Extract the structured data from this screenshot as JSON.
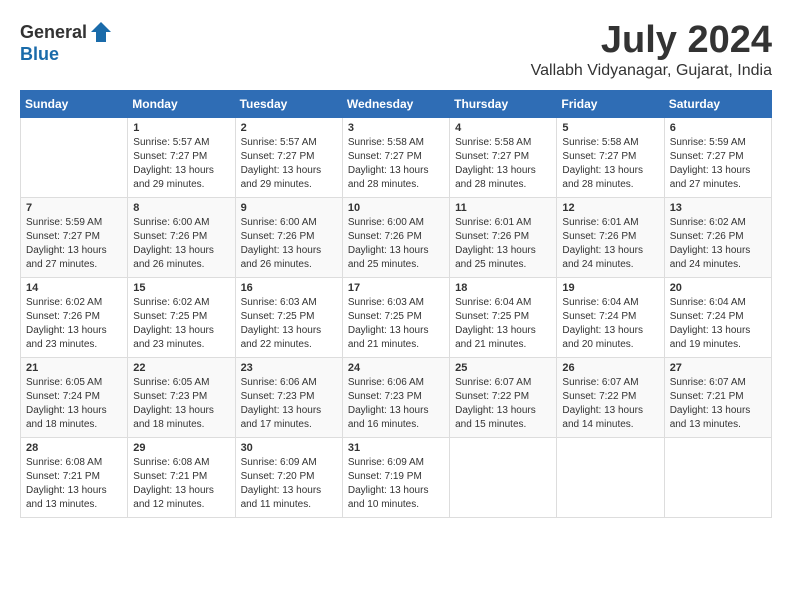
{
  "header": {
    "logo_general": "General",
    "logo_blue": "Blue",
    "month_title": "July 2024",
    "location": "Vallabh Vidyanagar, Gujarat, India"
  },
  "calendar": {
    "days_of_week": [
      "Sunday",
      "Monday",
      "Tuesday",
      "Wednesday",
      "Thursday",
      "Friday",
      "Saturday"
    ],
    "weeks": [
      [
        {
          "day": "",
          "info": ""
        },
        {
          "day": "1",
          "info": "Sunrise: 5:57 AM\nSunset: 7:27 PM\nDaylight: 13 hours\nand 29 minutes."
        },
        {
          "day": "2",
          "info": "Sunrise: 5:57 AM\nSunset: 7:27 PM\nDaylight: 13 hours\nand 29 minutes."
        },
        {
          "day": "3",
          "info": "Sunrise: 5:58 AM\nSunset: 7:27 PM\nDaylight: 13 hours\nand 28 minutes."
        },
        {
          "day": "4",
          "info": "Sunrise: 5:58 AM\nSunset: 7:27 PM\nDaylight: 13 hours\nand 28 minutes."
        },
        {
          "day": "5",
          "info": "Sunrise: 5:58 AM\nSunset: 7:27 PM\nDaylight: 13 hours\nand 28 minutes."
        },
        {
          "day": "6",
          "info": "Sunrise: 5:59 AM\nSunset: 7:27 PM\nDaylight: 13 hours\nand 27 minutes."
        }
      ],
      [
        {
          "day": "7",
          "info": "Sunrise: 5:59 AM\nSunset: 7:27 PM\nDaylight: 13 hours\nand 27 minutes."
        },
        {
          "day": "8",
          "info": "Sunrise: 6:00 AM\nSunset: 7:26 PM\nDaylight: 13 hours\nand 26 minutes."
        },
        {
          "day": "9",
          "info": "Sunrise: 6:00 AM\nSunset: 7:26 PM\nDaylight: 13 hours\nand 26 minutes."
        },
        {
          "day": "10",
          "info": "Sunrise: 6:00 AM\nSunset: 7:26 PM\nDaylight: 13 hours\nand 25 minutes."
        },
        {
          "day": "11",
          "info": "Sunrise: 6:01 AM\nSunset: 7:26 PM\nDaylight: 13 hours\nand 25 minutes."
        },
        {
          "day": "12",
          "info": "Sunrise: 6:01 AM\nSunset: 7:26 PM\nDaylight: 13 hours\nand 24 minutes."
        },
        {
          "day": "13",
          "info": "Sunrise: 6:02 AM\nSunset: 7:26 PM\nDaylight: 13 hours\nand 24 minutes."
        }
      ],
      [
        {
          "day": "14",
          "info": "Sunrise: 6:02 AM\nSunset: 7:26 PM\nDaylight: 13 hours\nand 23 minutes."
        },
        {
          "day": "15",
          "info": "Sunrise: 6:02 AM\nSunset: 7:25 PM\nDaylight: 13 hours\nand 23 minutes."
        },
        {
          "day": "16",
          "info": "Sunrise: 6:03 AM\nSunset: 7:25 PM\nDaylight: 13 hours\nand 22 minutes."
        },
        {
          "day": "17",
          "info": "Sunrise: 6:03 AM\nSunset: 7:25 PM\nDaylight: 13 hours\nand 21 minutes."
        },
        {
          "day": "18",
          "info": "Sunrise: 6:04 AM\nSunset: 7:25 PM\nDaylight: 13 hours\nand 21 minutes."
        },
        {
          "day": "19",
          "info": "Sunrise: 6:04 AM\nSunset: 7:24 PM\nDaylight: 13 hours\nand 20 minutes."
        },
        {
          "day": "20",
          "info": "Sunrise: 6:04 AM\nSunset: 7:24 PM\nDaylight: 13 hours\nand 19 minutes."
        }
      ],
      [
        {
          "day": "21",
          "info": "Sunrise: 6:05 AM\nSunset: 7:24 PM\nDaylight: 13 hours\nand 18 minutes."
        },
        {
          "day": "22",
          "info": "Sunrise: 6:05 AM\nSunset: 7:23 PM\nDaylight: 13 hours\nand 18 minutes."
        },
        {
          "day": "23",
          "info": "Sunrise: 6:06 AM\nSunset: 7:23 PM\nDaylight: 13 hours\nand 17 minutes."
        },
        {
          "day": "24",
          "info": "Sunrise: 6:06 AM\nSunset: 7:23 PM\nDaylight: 13 hours\nand 16 minutes."
        },
        {
          "day": "25",
          "info": "Sunrise: 6:07 AM\nSunset: 7:22 PM\nDaylight: 13 hours\nand 15 minutes."
        },
        {
          "day": "26",
          "info": "Sunrise: 6:07 AM\nSunset: 7:22 PM\nDaylight: 13 hours\nand 14 minutes."
        },
        {
          "day": "27",
          "info": "Sunrise: 6:07 AM\nSunset: 7:21 PM\nDaylight: 13 hours\nand 13 minutes."
        }
      ],
      [
        {
          "day": "28",
          "info": "Sunrise: 6:08 AM\nSunset: 7:21 PM\nDaylight: 13 hours\nand 13 minutes."
        },
        {
          "day": "29",
          "info": "Sunrise: 6:08 AM\nSunset: 7:21 PM\nDaylight: 13 hours\nand 12 minutes."
        },
        {
          "day": "30",
          "info": "Sunrise: 6:09 AM\nSunset: 7:20 PM\nDaylight: 13 hours\nand 11 minutes."
        },
        {
          "day": "31",
          "info": "Sunrise: 6:09 AM\nSunset: 7:19 PM\nDaylight: 13 hours\nand 10 minutes."
        },
        {
          "day": "",
          "info": ""
        },
        {
          "day": "",
          "info": ""
        },
        {
          "day": "",
          "info": ""
        }
      ]
    ]
  }
}
